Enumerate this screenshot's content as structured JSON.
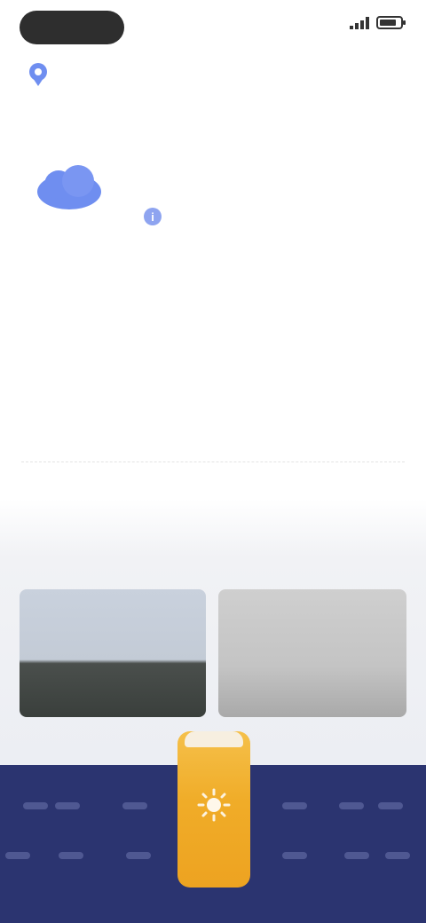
{
  "status_bar": {
    "time": "",
    "signal_icon": "signal-icon",
    "battery_icon": "battery-icon"
  },
  "header": {
    "location_icon": "location-pin-icon",
    "location_label": "",
    "title": ""
  },
  "current": {
    "heading": "",
    "icon": "cloud-icon",
    "temperature": "",
    "condition": "",
    "info_icon": "info-icon",
    "details": [
      {
        "label": "",
        "value": ""
      },
      {
        "label": "",
        "value": ""
      },
      {
        "label": "",
        "value": ""
      },
      {
        "label": "",
        "value": ""
      },
      {
        "label": "",
        "value": ""
      }
    ],
    "more_label": ""
  },
  "maps": {
    "heading": "",
    "cards": [
      {
        "caption": ""
      },
      {
        "caption": ""
      }
    ]
  },
  "bottom_nav": {
    "items": [
      {
        "label": ""
      },
      {
        "label": ""
      },
      {
        "label": ""
      },
      {
        "label": ""
      },
      {
        "label": ""
      },
      {
        "label": ""
      },
      {
        "label": ""
      },
      {
        "label": ""
      },
      {
        "label": ""
      },
      {
        "label": ""
      },
      {
        "label": ""
      },
      {
        "label": ""
      }
    ],
    "center_icon": "sun-icon",
    "center_label": ""
  },
  "colors": {
    "accent": "#6f8ef0",
    "nav_background": "#2b3470",
    "center_button": "#f0ac28"
  }
}
